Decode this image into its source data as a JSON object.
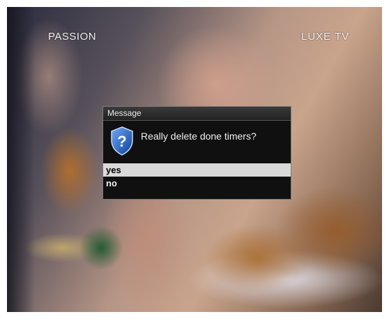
{
  "channel": {
    "left_logo": "PASSION",
    "right_logo": "LUXE TV"
  },
  "dialog": {
    "title": "Message",
    "icon": "question-shield-icon",
    "text": "Really delete done timers?",
    "options": [
      {
        "label": "yes",
        "selected": true
      },
      {
        "label": "no",
        "selected": false
      }
    ]
  },
  "colors": {
    "dialog_bg": "#101010",
    "selected_bg": "#d9d9d9",
    "icon_blue": "#1f5fb0"
  }
}
